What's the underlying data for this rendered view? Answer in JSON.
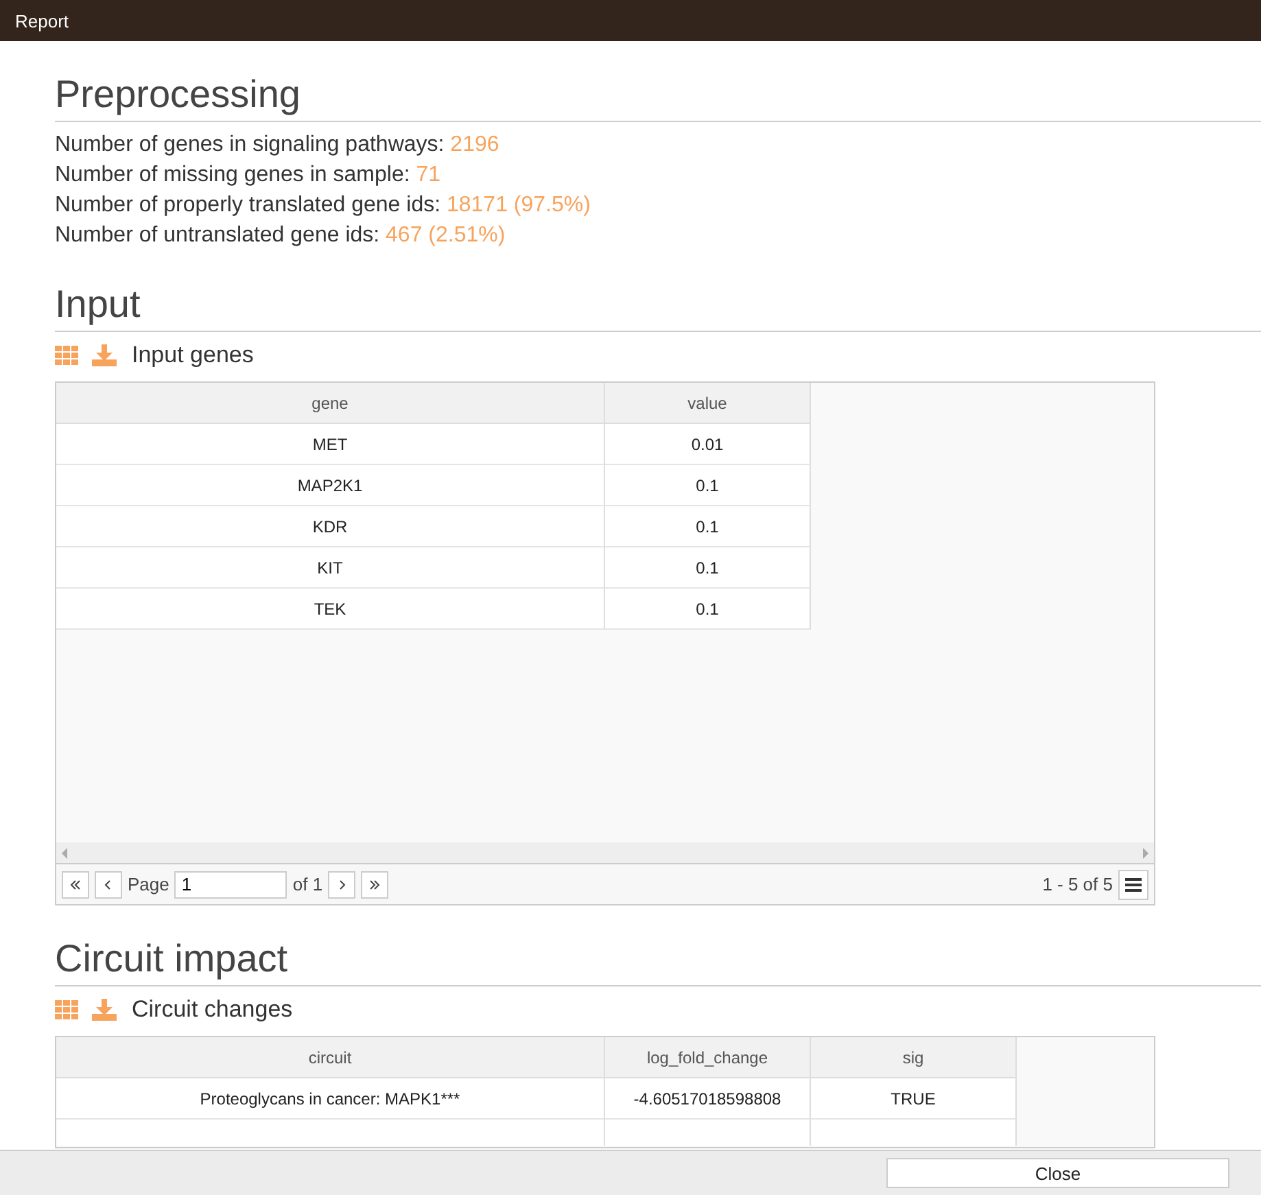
{
  "window": {
    "title": "Report"
  },
  "sections": [
    {
      "kind": "stats",
      "heading": "Preprocessing",
      "stats": [
        {
          "label": "Number of genes in signaling pathways:",
          "value": "2196"
        },
        {
          "label": "Number of missing genes in sample:",
          "value": "71"
        },
        {
          "label": "Number of properly translated gene ids:",
          "value": "18171 (97.5%)"
        },
        {
          "label": "Number of untranslated gene ids:",
          "value": "467 (2.51%)"
        }
      ]
    },
    {
      "kind": "table",
      "heading": "Input",
      "table_title": "Input genes",
      "columns": [
        "gene",
        "value"
      ],
      "rows": [
        [
          "MET",
          "0.01"
        ],
        [
          "MAP2K1",
          "0.1"
        ],
        [
          "KDR",
          "0.1"
        ],
        [
          "KIT",
          "0.1"
        ],
        [
          "TEK",
          "0.1"
        ]
      ],
      "pager": {
        "page_label": "Page",
        "page": "1",
        "of": "of 1",
        "range": "1 - 5 of 5"
      }
    },
    {
      "kind": "table",
      "heading": "Circuit impact",
      "table_title": "Circuit changes",
      "columns": [
        "circuit",
        "log_fold_change",
        "sig"
      ],
      "rows": [
        [
          "Proteoglycans in cancer: MAPK1***",
          "-4.60517018598808",
          "TRUE"
        ]
      ]
    }
  ],
  "footer": {
    "button": "Close"
  }
}
